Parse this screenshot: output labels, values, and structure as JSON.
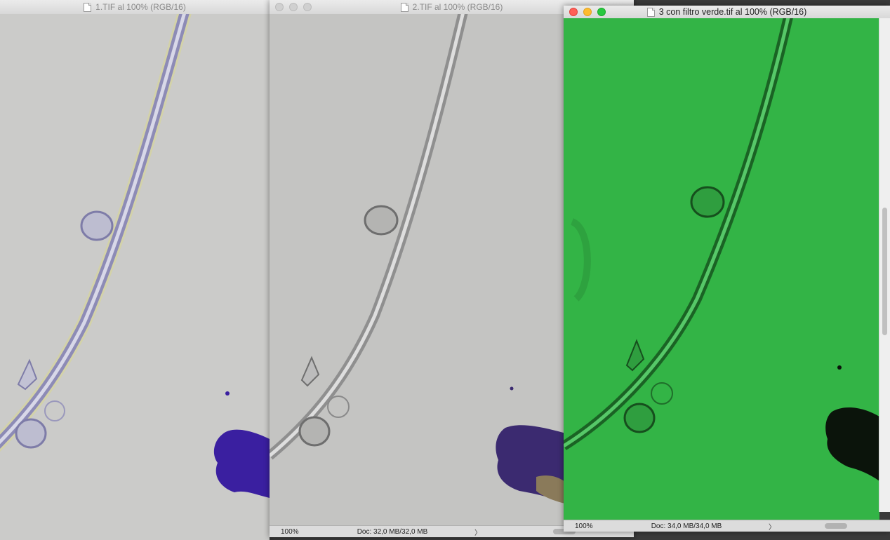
{
  "windows": [
    {
      "title": "1.TIF al 100% (RGB/16)",
      "image_tint": "purple-fringe",
      "colors": {
        "background": "#cbcbc9",
        "strand": "#8d8bb6",
        "debris": "#3a1fa0"
      }
    },
    {
      "title": "2.TIF al 100% (RGB/16)",
      "zoom": "100%",
      "doc_info": "Doc: 32,0 MB/32,0 MB",
      "arrow": "〉",
      "image_tint": "neutral",
      "colors": {
        "background": "#c4c4c2",
        "strand": "#8f8f8f",
        "debris": "#3b2a70"
      }
    },
    {
      "title": "3 con filtro verde.tif al 100% (RGB/16)",
      "zoom": "100%",
      "doc_info": "Doc: 34,0 MB/34,0 MB",
      "arrow": "〉",
      "image_tint": "green-filter",
      "active": true,
      "colors": {
        "background": "#33b446",
        "strand": "#1a6324",
        "debris": "#0b140b"
      }
    }
  ]
}
